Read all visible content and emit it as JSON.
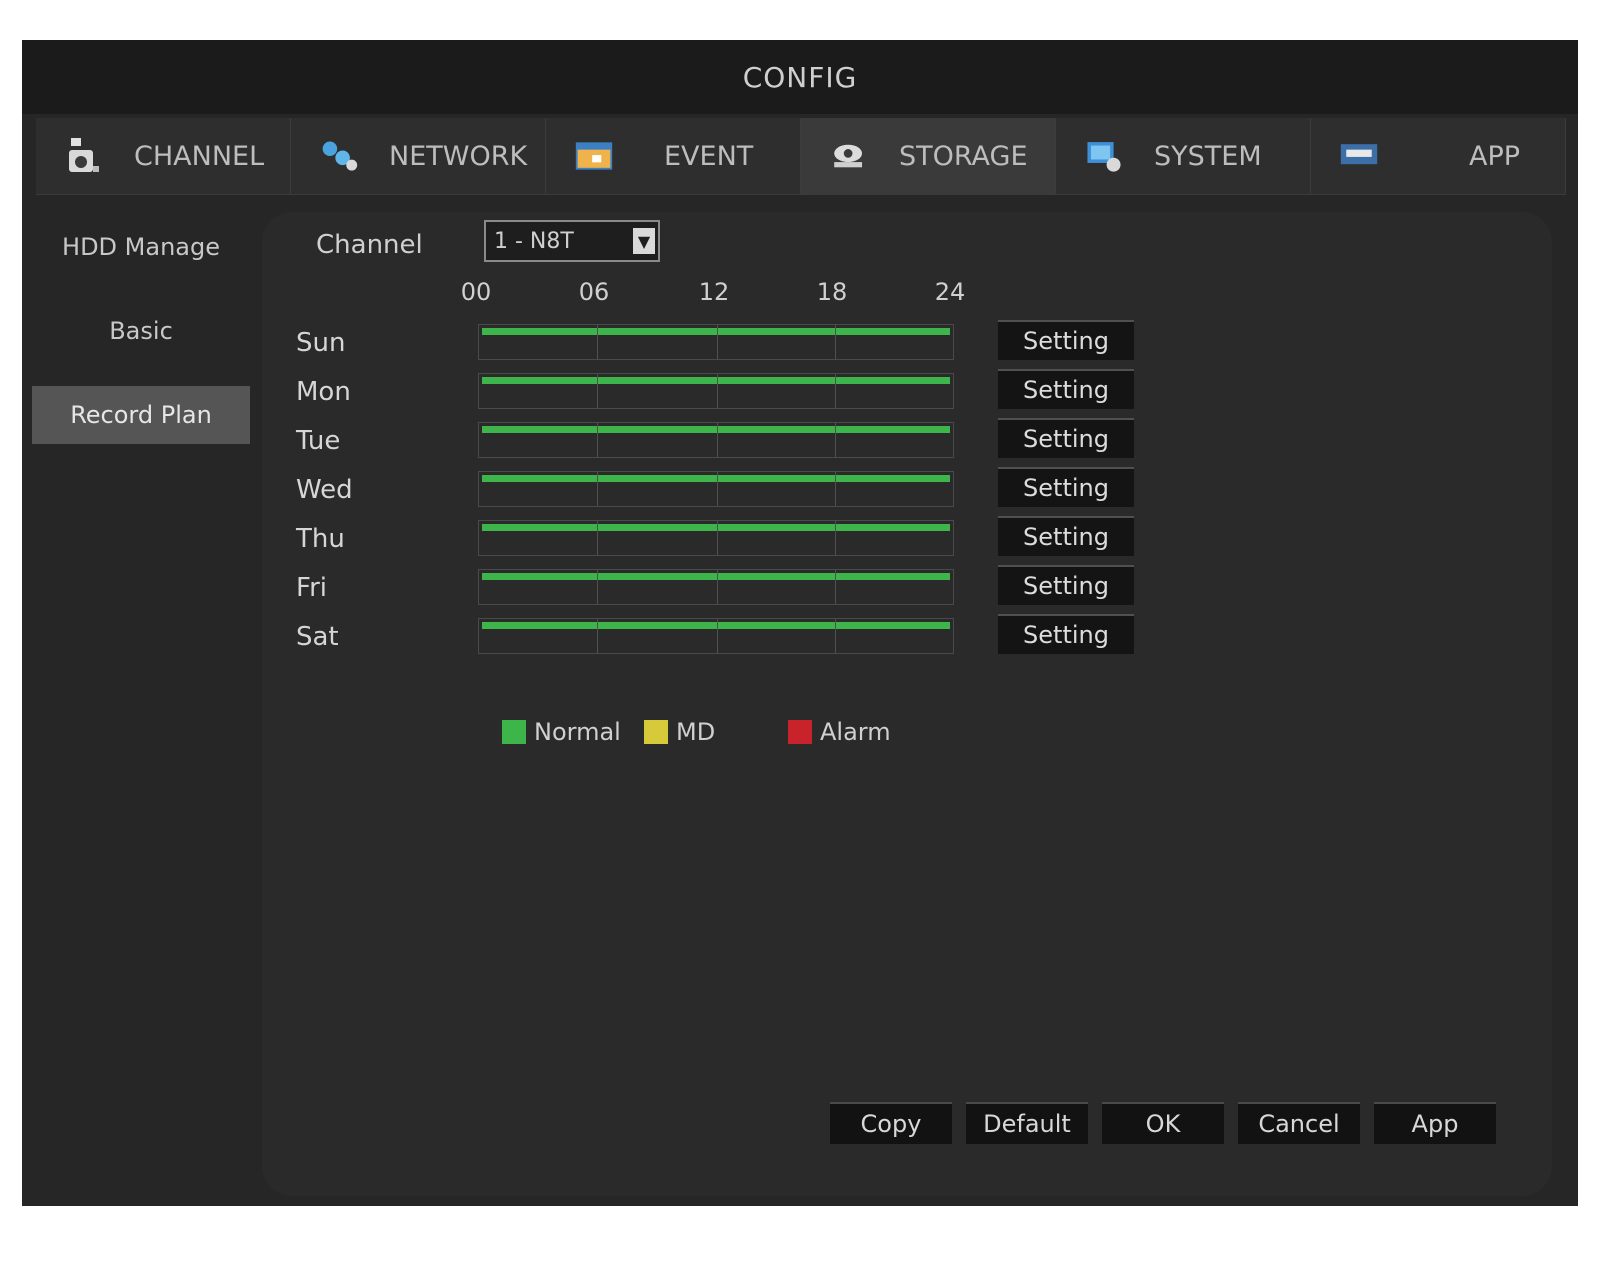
{
  "window": {
    "title": "CONFIG"
  },
  "tabs": [
    {
      "label": "CHANNEL",
      "icon": "camera-icon",
      "active": false
    },
    {
      "label": "NETWORK",
      "icon": "network-icon",
      "active": false
    },
    {
      "label": "EVENT",
      "icon": "event-icon",
      "active": false
    },
    {
      "label": "STORAGE",
      "icon": "storage-icon",
      "active": true
    },
    {
      "label": "SYSTEM",
      "icon": "system-icon",
      "active": false
    },
    {
      "label": "APP",
      "icon": "app-icon",
      "active": false
    }
  ],
  "sidebar": {
    "items": [
      {
        "label": "HDD Manage",
        "active": false
      },
      {
        "label": "Basic",
        "active": false
      },
      {
        "label": "Record Plan",
        "active": true
      }
    ]
  },
  "channel": {
    "label": "Channel",
    "value": "1 - N8T"
  },
  "timeline": {
    "hours": [
      "00",
      "06",
      "12",
      "18",
      "24"
    ]
  },
  "days": [
    {
      "label": "Sun",
      "setting": "Setting"
    },
    {
      "label": "Mon",
      "setting": "Setting"
    },
    {
      "label": "Tue",
      "setting": "Setting"
    },
    {
      "label": "Wed",
      "setting": "Setting"
    },
    {
      "label": "Thu",
      "setting": "Setting"
    },
    {
      "label": "Fri",
      "setting": "Setting"
    },
    {
      "label": "Sat",
      "setting": "Setting"
    }
  ],
  "legend": [
    {
      "label": "Normal",
      "color": "#3db54a"
    },
    {
      "label": "MD",
      "color": "#d6c93a"
    },
    {
      "label": "Alarm",
      "color": "#c8232a"
    }
  ],
  "buttons": {
    "copy": "Copy",
    "default": "Default",
    "ok": "OK",
    "cancel": "Cancel",
    "apply": "App"
  }
}
